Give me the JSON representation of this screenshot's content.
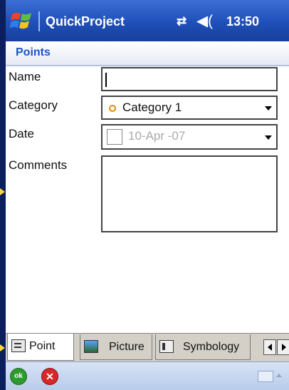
{
  "titlebar": {
    "app_title": "QuickProject",
    "clock": "13:50",
    "icons": [
      "windows-start-icon",
      "sync-icon",
      "volume-icon"
    ]
  },
  "form": {
    "heading": "Points",
    "name_label": "Name",
    "name_value": "",
    "category_label": "Category",
    "category_value": "Category 1",
    "date_label": "Date",
    "date_value": "10-Apr -07",
    "comments_label": "Comments",
    "comments_value": ""
  },
  "tabs": [
    {
      "label": "Point",
      "icon": "point-tab-icon",
      "active": true
    },
    {
      "label": "Picture",
      "icon": "picture-tab-icon",
      "active": false
    },
    {
      "label": "Symbology",
      "icon": "symbology-tab-icon",
      "active": false
    }
  ],
  "menubar": {
    "ok_label": "ok",
    "cancel_label": "✕"
  },
  "colors": {
    "titlebar": "#1f4fb8",
    "heading": "#1a55c2",
    "ok": "#2e9a2e",
    "cancel": "#d62828",
    "outer_bg": "#0b1f5e",
    "marker": "#f4d640"
  }
}
